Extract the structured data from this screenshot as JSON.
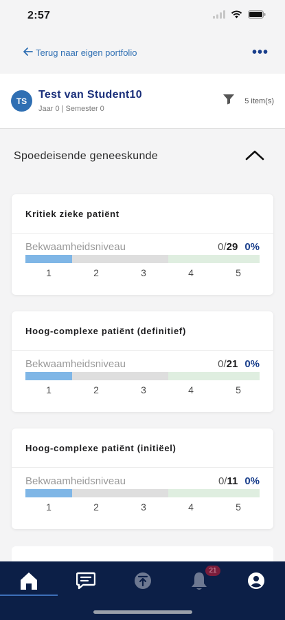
{
  "status": {
    "time": "2:57"
  },
  "nav": {
    "back_label": "Terug naar eigen portfolio",
    "more_label": "•••"
  },
  "student": {
    "initials": "TS",
    "name": "Test van Student10",
    "meta": "Jaar 0 | Semester 0",
    "item_count": "5 item(s)"
  },
  "section": {
    "title": "Spoedeisende geneeskunde"
  },
  "cards": [
    {
      "title": "Kritiek zieke patiënt",
      "level_label": "Bekwaamheidsniveau",
      "achieved": "0",
      "total": "29",
      "percent": "0%",
      "ticks": [
        "1",
        "2",
        "3",
        "4",
        "5"
      ]
    },
    {
      "title": "Hoog-complexe patiënt (definitief)",
      "level_label": "Bekwaamheidsniveau",
      "achieved": "0",
      "total": "21",
      "percent": "0%",
      "ticks": [
        "1",
        "2",
        "3",
        "4",
        "5"
      ]
    },
    {
      "title": "Hoog-complexe patiënt (initiëel)",
      "level_label": "Bekwaamheidsniveau",
      "achieved": "0",
      "total": "11",
      "percent": "0%",
      "ticks": [
        "1",
        "2",
        "3",
        "4",
        "5"
      ]
    }
  ],
  "tabbar": {
    "notification_badge": "21"
  },
  "colors": {
    "accent": "#1a3f8c",
    "link": "#2f6fb3",
    "bar_fill": "#7fb6e6",
    "tab_bar_bg": "#0c1f47",
    "badge_bg": "#7a1d3b"
  },
  "icons": [
    "back-arrow-icon",
    "more-icon",
    "filter-icon",
    "chevron-up-icon",
    "home-icon",
    "chat-icon",
    "upload-icon",
    "bell-icon",
    "profile-icon"
  ]
}
